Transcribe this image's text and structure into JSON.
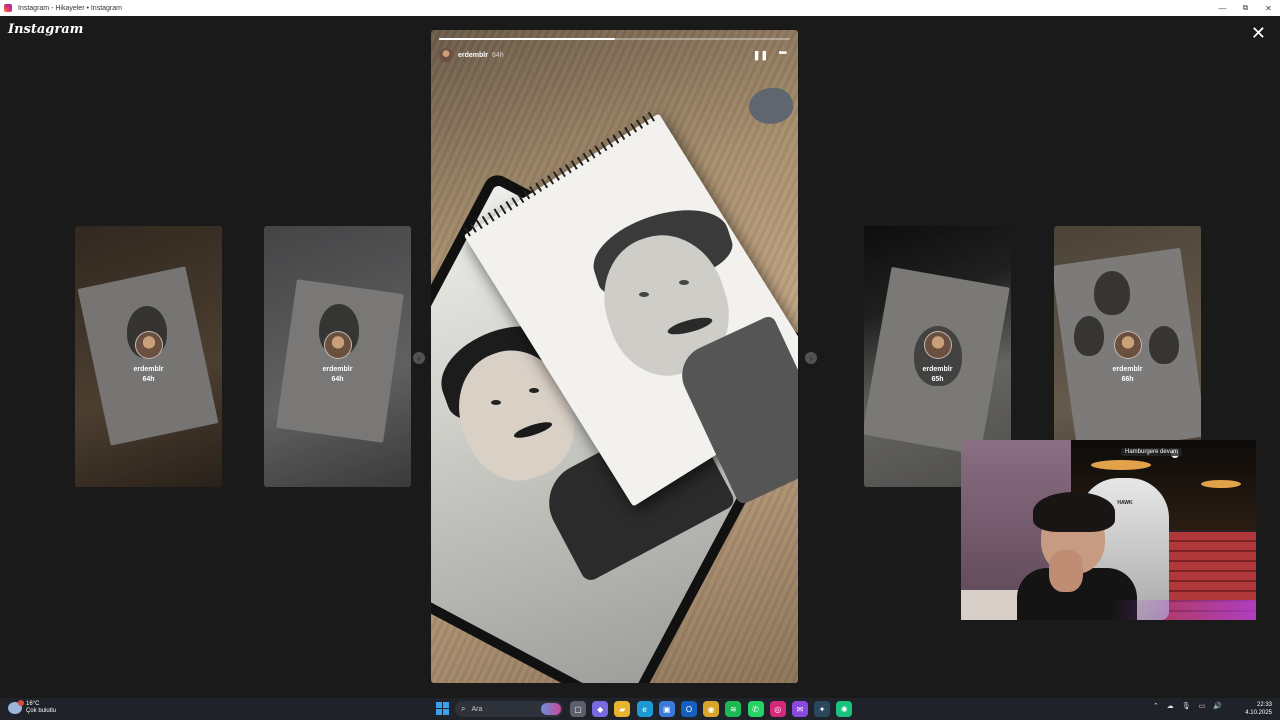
{
  "window": {
    "title": "Instagram - Hikayeler • Instagram",
    "minimize": "—",
    "restore": "⧉",
    "close": "✕"
  },
  "app": {
    "logo": "Instagram",
    "close_icon": "close-icon"
  },
  "main_story": {
    "username": "erdemblr",
    "age": "64h",
    "progress_fraction": 0.5,
    "pause_icon": "pause-icon",
    "more_icon": "more-icon",
    "pause_glyph": "❚❚",
    "more_glyph": "•••"
  },
  "side_stories": [
    {
      "username": "erdemblr",
      "age": "64h"
    },
    {
      "username": "erdemblr",
      "age": "64h"
    },
    {
      "username": "erdemblr",
      "age": "65h"
    },
    {
      "username": "erdemblr",
      "age": "66h"
    }
  ],
  "nav": {
    "prev": "‹",
    "next": "›"
  },
  "webcam": {
    "badge": "Hamburgere devam",
    "chair_label": "HAWK"
  },
  "taskbar": {
    "weather_temp": "16°C",
    "weather_desc": "Çok bulutlu",
    "search_placeholder": "Ara",
    "time": "22:33",
    "date": "4.10.2025",
    "apps": [
      {
        "name": "task-view-icon",
        "color": "#5a5f6a",
        "glyph": "▢"
      },
      {
        "name": "copilot-icon",
        "color": "#7a6ae0",
        "glyph": "◆"
      },
      {
        "name": "file-explorer-icon",
        "color": "#e8b32e",
        "glyph": "▰"
      },
      {
        "name": "edge-icon",
        "color": "#1c9ad6",
        "glyph": "e"
      },
      {
        "name": "store-icon",
        "color": "#3a7ad8",
        "glyph": "▣"
      },
      {
        "name": "outlook-icon",
        "color": "#1560c0",
        "glyph": "O"
      },
      {
        "name": "chrome-icon",
        "color": "#d8a52a",
        "glyph": "◉"
      },
      {
        "name": "spotify-icon",
        "color": "#1db954",
        "glyph": "≋"
      },
      {
        "name": "whatsapp-icon",
        "color": "#25d366",
        "glyph": "✆"
      },
      {
        "name": "instagram-icon",
        "color": "#d6297b",
        "glyph": "◎"
      },
      {
        "name": "messenger-icon",
        "color": "#8a4ae0",
        "glyph": "✉"
      },
      {
        "name": "steam-icon",
        "color": "#2a475e",
        "glyph": "✦"
      },
      {
        "name": "chatgpt-icon",
        "color": "#19c37d",
        "glyph": "✺"
      }
    ],
    "tray": [
      "⌃",
      "☁",
      "🎙",
      "▭",
      "🔊"
    ]
  }
}
